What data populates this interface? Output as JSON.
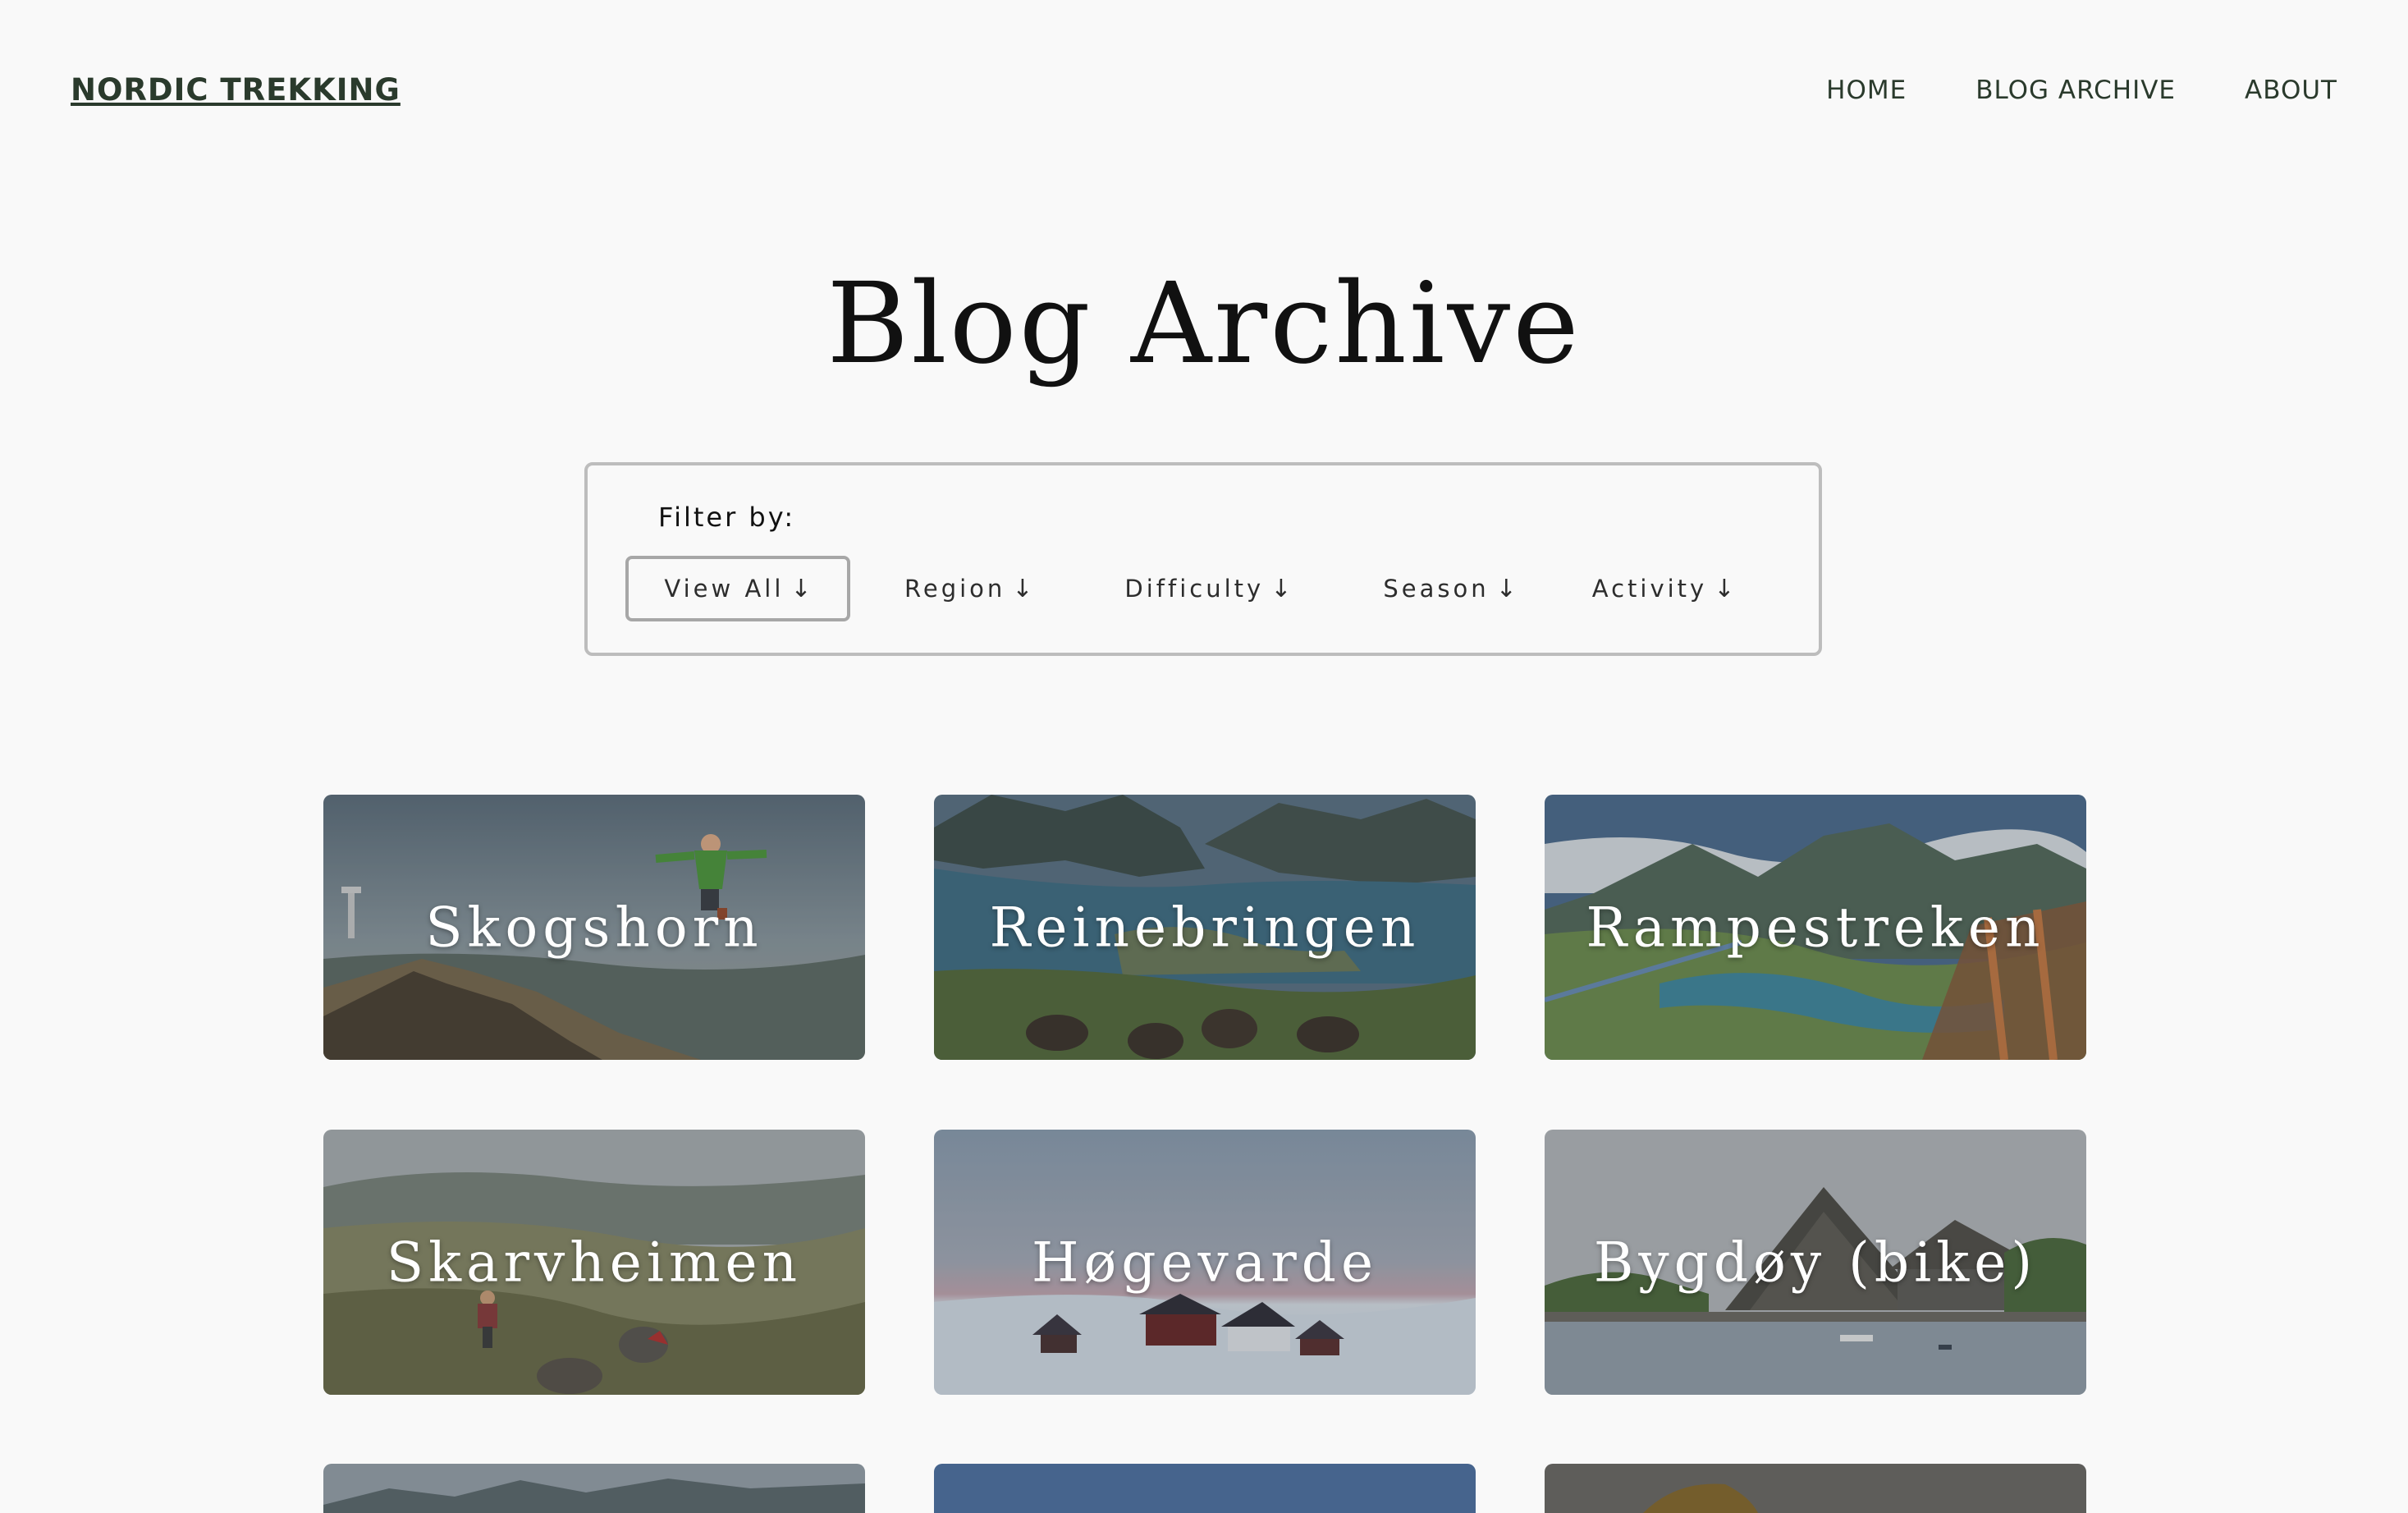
{
  "header": {
    "brand": "NORDIC TREKKING",
    "nav": [
      {
        "label": "HOME"
      },
      {
        "label": "BLOG ARCHIVE"
      },
      {
        "label": "ABOUT"
      }
    ]
  },
  "page_title": "Blog Archive",
  "filter": {
    "label": "Filter by:",
    "arrow": "↓",
    "options": [
      {
        "label": "View All",
        "active": true
      },
      {
        "label": "Region",
        "active": false
      },
      {
        "label": "Difficulty",
        "active": false
      },
      {
        "label": "Season",
        "active": false
      },
      {
        "label": "Activity",
        "active": false
      }
    ]
  },
  "posts": [
    {
      "title": "Skogshorn"
    },
    {
      "title": "Reinebringen"
    },
    {
      "title": "Rampestreken"
    },
    {
      "title": "Skarvheimen"
    },
    {
      "title": "Høgevarde"
    },
    {
      "title": "Bygdøy (bike)"
    }
  ]
}
